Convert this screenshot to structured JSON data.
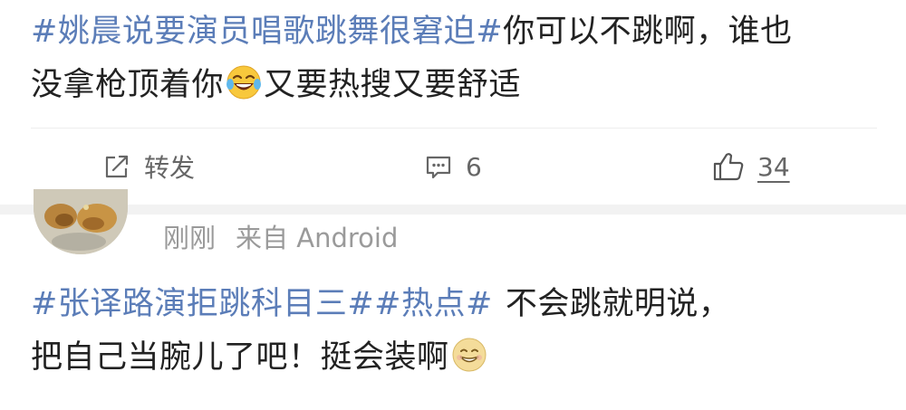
{
  "post_1": {
    "topic": "#姚晨说要演员唱歌跳舞很窘迫#",
    "text_line1": "你可以不跳啊，谁也",
    "text_line2_a": "没拿枪顶着你",
    "emoji": "laughing-crying-emoji",
    "text_line2_b": "又要热搜又要舒适"
  },
  "actions": {
    "repost_label": "转发",
    "comment_count": "6",
    "like_count": "34"
  },
  "comment_2": {
    "time": "刚刚",
    "source": "来自 Android",
    "topic_1": "#张译路演拒跳科目三#",
    "topic_2": "#热点#",
    "text_line1": "不会跳就明说，",
    "text_line2": "把自己当腕儿了吧！挺会装啊",
    "emoji": "grinning-emoji"
  },
  "colors": {
    "topic_link": "#5b7db8",
    "text": "#222222",
    "meta": "#9a9a9a",
    "action": "#666666",
    "separator": "#f2f2f2"
  }
}
